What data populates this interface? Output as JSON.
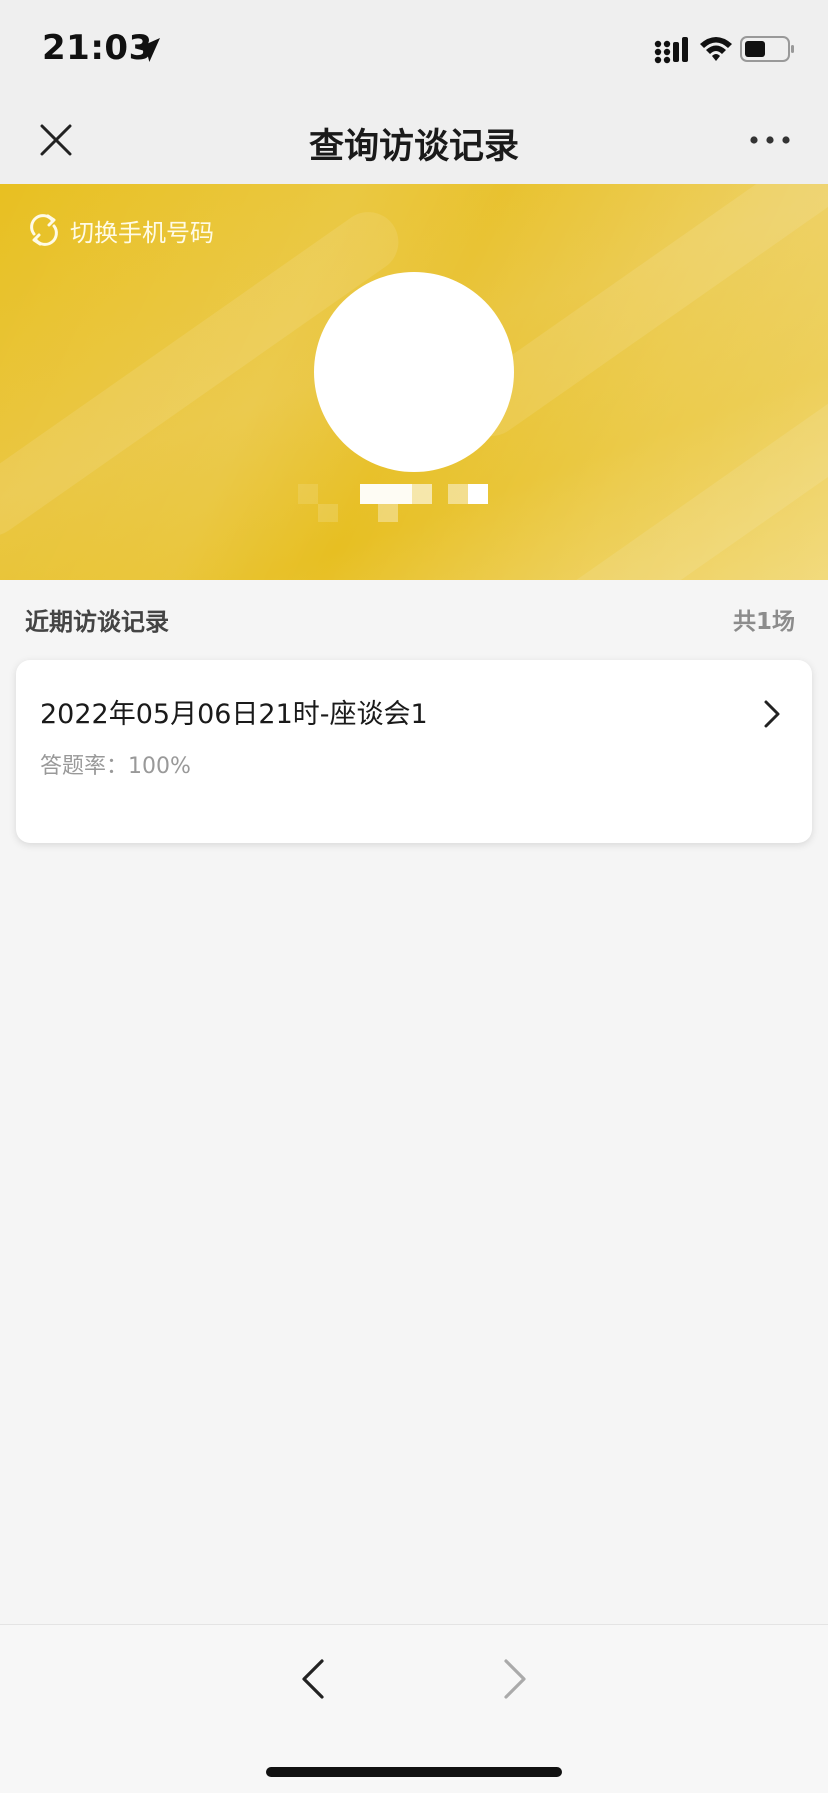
{
  "status_bar": {
    "time": "21:03",
    "icons": [
      "location-arrow-icon",
      "signal-icon",
      "wifi-icon",
      "battery-icon"
    ]
  },
  "nav": {
    "title": "查询访谈记录",
    "close_icon": "close-icon",
    "more_icon": "more-icon"
  },
  "profile": {
    "switch_label": "切换手机号码",
    "switch_icon": "refresh-icon",
    "banner_color": "#e8c021"
  },
  "records": {
    "section_title": "近期访谈记录",
    "count_label": "共1场",
    "items": [
      {
        "title": "2022年05月06日21时-座谈会1",
        "rate_label": "答题率：100%"
      }
    ]
  },
  "toolbar": {
    "back_icon": "chevron-left-icon",
    "forward_icon": "chevron-right-icon"
  }
}
